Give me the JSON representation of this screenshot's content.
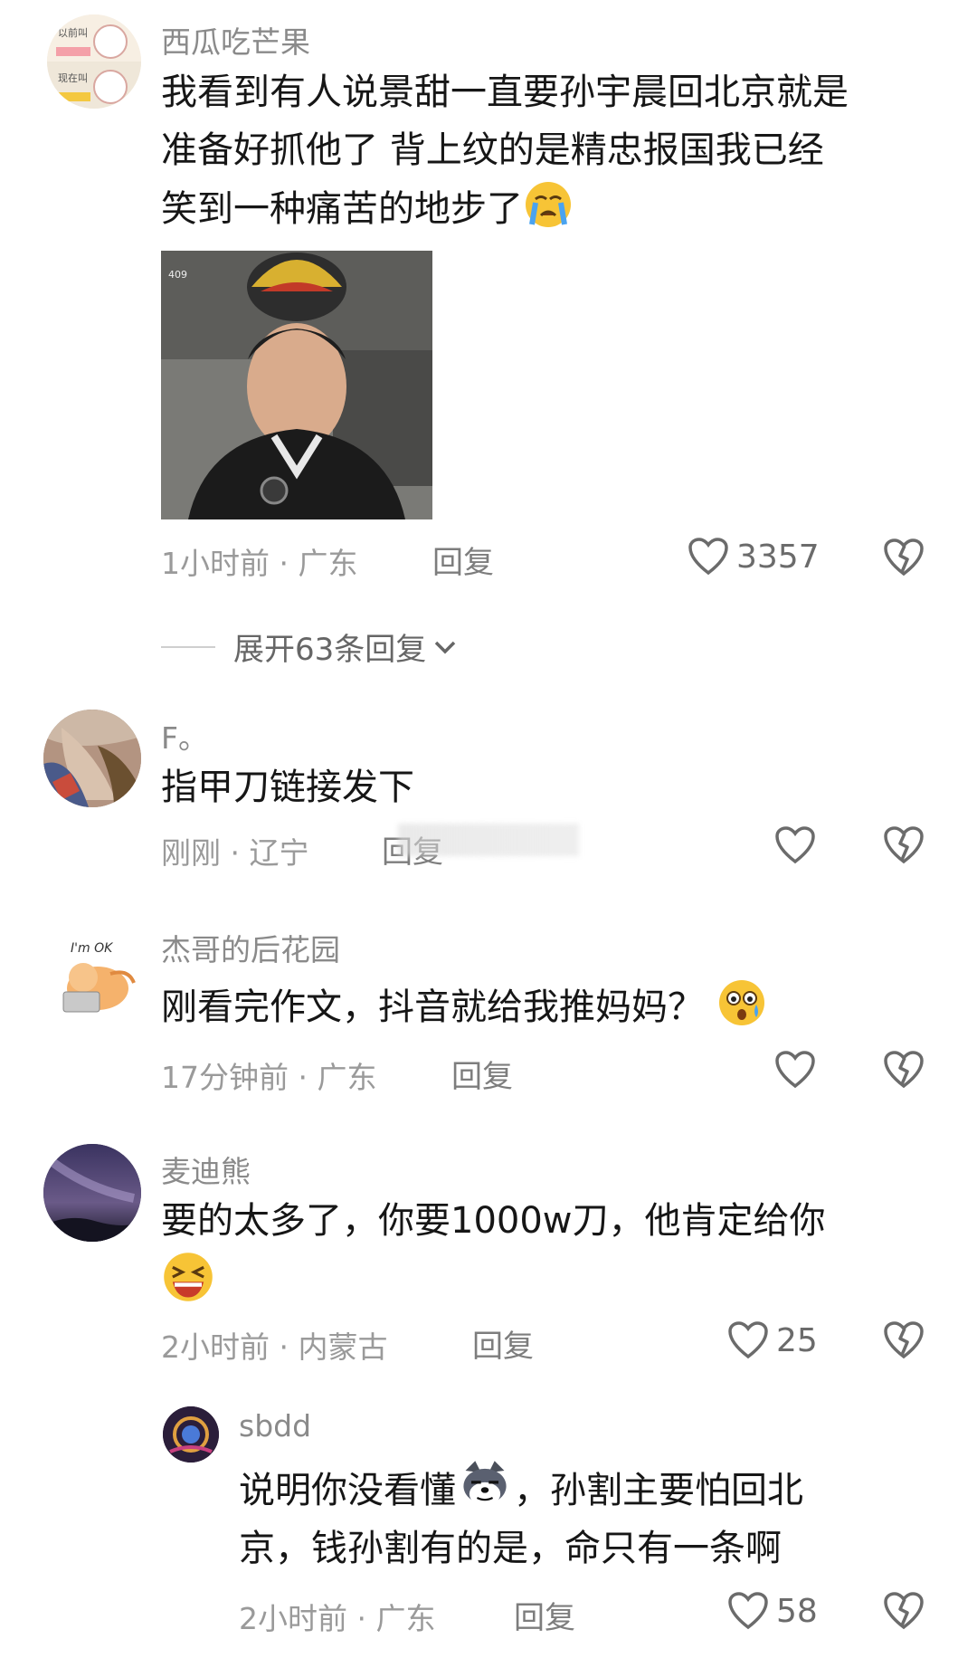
{
  "comments": [
    {
      "username": "西瓜吃芒果",
      "text": "我看到有人说景甜一直要孙宇晨回北京就是准备好抓他了 背上纹的是精忠报国我已经笑到一种痛苦的地步了",
      "line1": "我看到有人说景甜一直要孙宇晨回北京就是",
      "line2": "准备好抓他了 背上纹的是精忠报国我已经",
      "line3": "笑到一种痛苦的地步了",
      "photo_badge": "409",
      "time": "1小时前 · 广东",
      "reply_label": "回复",
      "likes": "3357"
    },
    {
      "username": "F。",
      "text": "指甲刀链接发下",
      "time": "刚刚 · 辽宁",
      "reply_label": "回复",
      "likes": ""
    },
    {
      "username": "杰哥的后花园",
      "text": "刚看完作文，抖音就给我推妈妈？",
      "time": "17分钟前 · 广东",
      "reply_label": "回复",
      "likes": ""
    },
    {
      "username": "麦迪熊",
      "line1": "要的太多了，你要1000w刀，他肯定给你",
      "time": "2小时前 · 内蒙古",
      "reply_label": "回复",
      "likes": "25"
    }
  ],
  "expand_replies": "展开63条回复",
  "reply": {
    "username": "sbdd",
    "line1a": "说明你没看懂",
    "line1b": "，孙割主要怕回北",
    "line2": "京，钱孙割有的是，命只有一条啊",
    "time": "2小时前 · 广东",
    "reply_label": "回复",
    "likes": "58"
  },
  "avatar1_text": {
    "top": "以前叫",
    "bottom": "现在叫"
  },
  "avatar3_text": "I'm OK",
  "colors": {
    "text": "#161616",
    "meta": "#9a9a9a",
    "username": "#8a8a8a",
    "heart": "#6b6b6b"
  }
}
